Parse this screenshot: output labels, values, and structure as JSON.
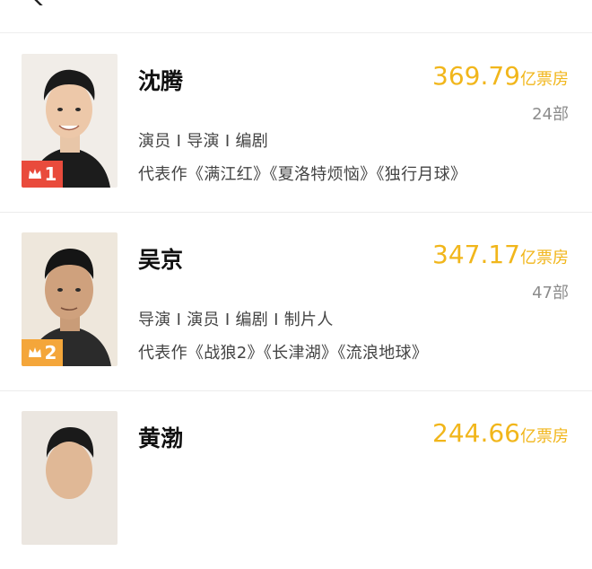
{
  "header": {
    "title": "",
    "back_icon": "back-chevron-icon"
  },
  "accent_colors": {
    "box_office": "#f1b61b",
    "rank1": "#e94b3c",
    "rank2": "#f4a63a"
  },
  "list": [
    {
      "name": "沈腾",
      "box_office_value": "369.79",
      "box_office_unit": "亿票房",
      "works": "24部",
      "roles": "演员 I 导演 I 编剧",
      "representative": "代表作《满江红》《夏洛特烦恼》《独行月球》",
      "rank": "1",
      "rank_icon": "crown-icon"
    },
    {
      "name": "吴京",
      "box_office_value": "347.17",
      "box_office_unit": "亿票房",
      "works": "47部",
      "roles": "导演 I 演员 I 编剧 I 制片人",
      "representative": "代表作《战狼2》《长津湖》《流浪地球》",
      "rank": "2",
      "rank_icon": "crown-icon"
    },
    {
      "name": "黄渤",
      "box_office_value": "244.66",
      "box_office_unit": "亿票房"
    }
  ]
}
